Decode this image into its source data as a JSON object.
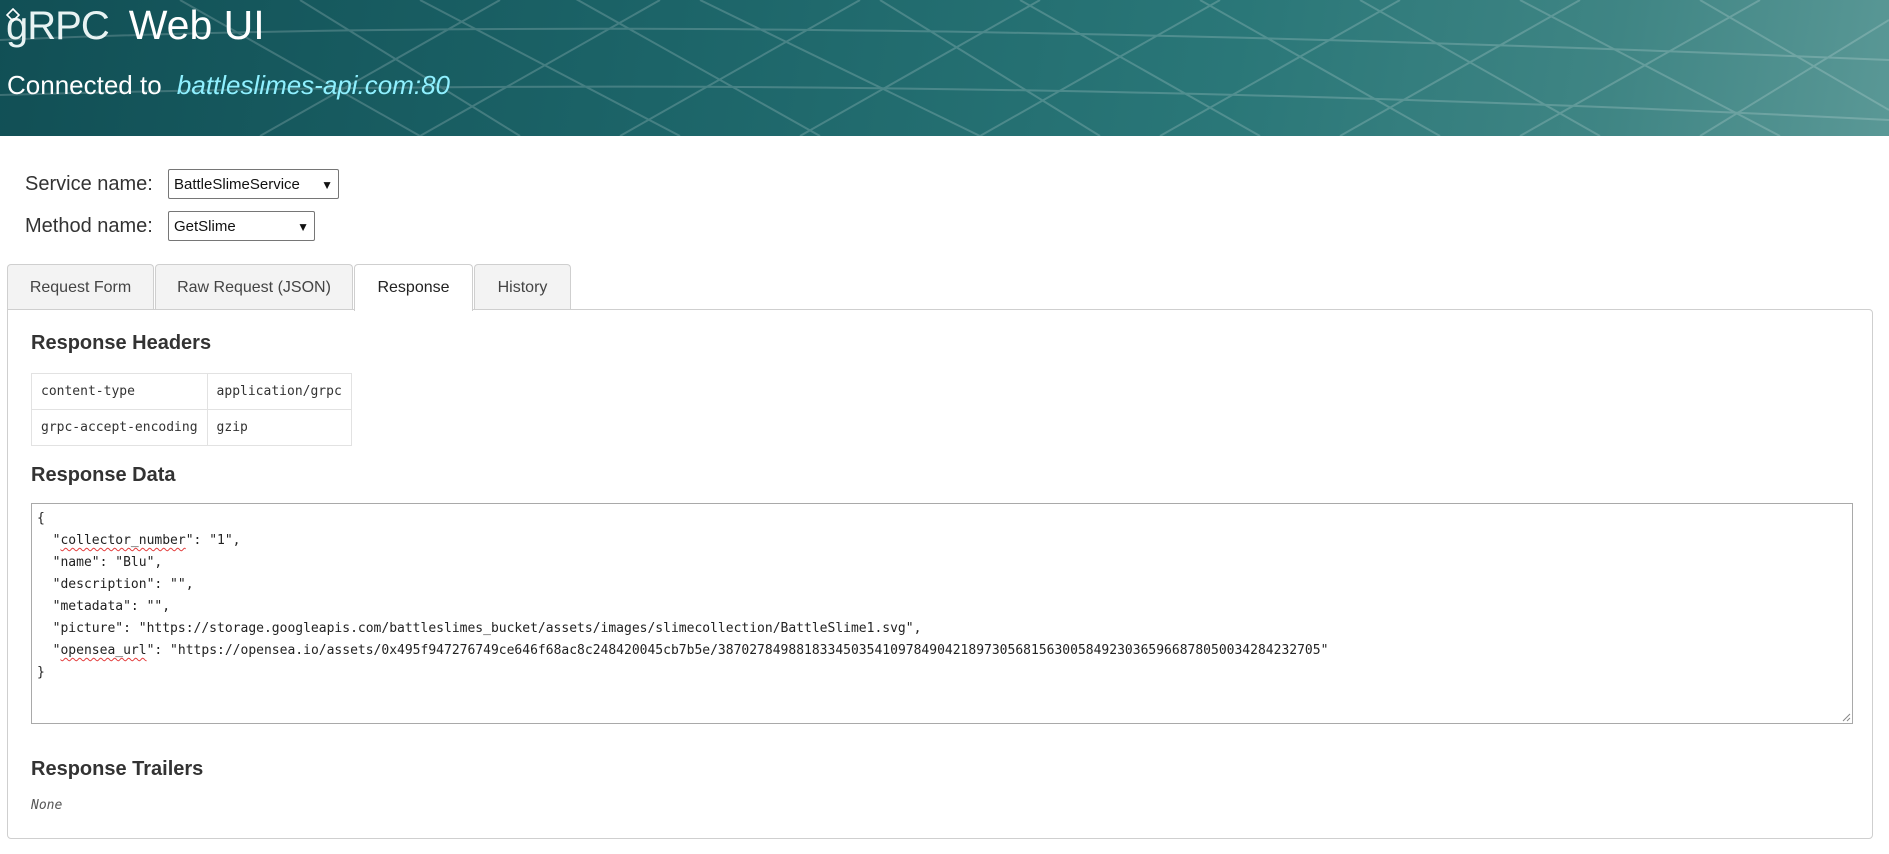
{
  "header": {
    "logo_text": "gRPC",
    "title": "Web UI",
    "connected_label": "Connected to",
    "host": "battleslimes-api.com:80"
  },
  "selectors": {
    "service_label": "Service name:",
    "service_value": "BattleSlimeService",
    "method_label": "Method name:",
    "method_value": "GetSlime"
  },
  "tabs": [
    {
      "label": "Request Form",
      "active": false
    },
    {
      "label": "Raw Request (JSON)",
      "active": false
    },
    {
      "label": "Response",
      "active": true
    },
    {
      "label": "History",
      "active": false
    }
  ],
  "response": {
    "headers_title": "Response Headers",
    "headers": [
      {
        "key": "content-type",
        "value": "application/grpc"
      },
      {
        "key": "grpc-accept-encoding",
        "value": "gzip"
      }
    ],
    "data_title": "Response Data",
    "data_lines": {
      "open": "{",
      "l1_pre": "  \"",
      "l1_key": "collector_number",
      "l1_post": "\": \"1\",",
      "l2": "  \"name\": \"Blu\",",
      "l3": "  \"description\": \"\",",
      "l4": "  \"metadata\": \"\",",
      "l5": "  \"picture\": \"https://storage.googleapis.com/battleslimes_bucket/assets/images/slimecollection/BattleSlime1.svg\",",
      "l6_pre": "  \"",
      "l6_key": "opensea_url",
      "l6_post": "\": \"https://opensea.io/assets/0x495f947276749ce646f68ac8c248420045cb7b5e/38702784988183345035410978490421897305681563005849230365966878050034284232705\"",
      "close": "}"
    },
    "trailers_title": "Response Trailers",
    "trailers_value": "None"
  },
  "colors": {
    "host_accent": "#8ff0ff",
    "header_bg": "#1c6468"
  }
}
